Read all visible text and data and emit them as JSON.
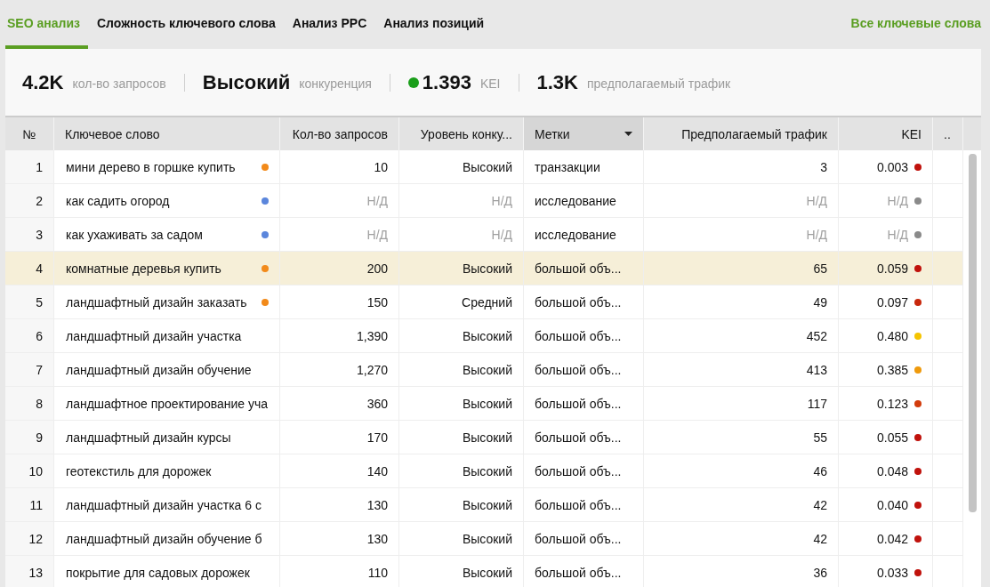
{
  "tabs": [
    {
      "label": "SEO анализ",
      "selected": true
    },
    {
      "label": "Сложность ключевого слова",
      "selected": false
    },
    {
      "label": "Анализ PPC",
      "selected": false
    },
    {
      "label": "Анализ позиций",
      "selected": false
    }
  ],
  "all_keywords_link": "Все ключевые слова",
  "summary": [
    {
      "value": "4.2K",
      "label": "кол-во запросов"
    },
    {
      "value": "Высокий",
      "label": "конкуренция"
    },
    {
      "value": "1.393",
      "label": "KEI",
      "color": "#1a9e1a"
    },
    {
      "value": "1.3K",
      "label": "предполагаемый трафик"
    }
  ],
  "table": {
    "columns": [
      {
        "label": "№",
        "kind": "plain"
      },
      {
        "label": "Ключевое слово",
        "kind": "plain"
      },
      {
        "label": "Кол-во запросов",
        "kind": "plain"
      },
      {
        "label": "Уровень конку...",
        "kind": "plain"
      },
      {
        "label": "Метки",
        "kind": "filter"
      },
      {
        "label": "Предполагаемый трафик",
        "kind": "plain"
      },
      {
        "label": "KEI",
        "kind": "plain"
      },
      {
        "label": "..",
        "kind": "plain"
      }
    ],
    "rows": [
      {
        "n": "1",
        "keyword": {
          "text": "мини дерево в горшке купить",
          "color": "#f28a1a"
        },
        "count": "10",
        "competition": "Высокий",
        "tag": "транзакции",
        "traffic": "3",
        "kei": {
          "value": "0.003",
          "color": "#c0120c"
        },
        "na": false,
        "selected": false
      },
      {
        "n": "2",
        "keyword": {
          "text": "как садить огород",
          "color": "#5b86dc"
        },
        "count": "Н/Д",
        "competition": "Н/Д",
        "tag": "исследование",
        "traffic": "Н/Д",
        "kei": {
          "value": "Н/Д",
          "color": "#8a8a8a"
        },
        "na": true,
        "selected": false
      },
      {
        "n": "3",
        "keyword": {
          "text": "как ухаживать за садом",
          "color": "#5b86dc"
        },
        "count": "Н/Д",
        "competition": "Н/Д",
        "tag": "исследование",
        "traffic": "Н/Д",
        "kei": {
          "value": "Н/Д",
          "color": "#8a8a8a"
        },
        "na": true,
        "selected": false
      },
      {
        "n": "4",
        "keyword": {
          "text": "комнатные деревья купить",
          "color": "#f28a1a"
        },
        "count": "200",
        "competition": "Высокий",
        "tag": "большой объ...",
        "traffic": "65",
        "kei": {
          "value": "0.059",
          "color": "#c0120c"
        },
        "na": false,
        "selected": true
      },
      {
        "n": "5",
        "keyword": {
          "text": "ландшафтный дизайн заказать",
          "color": "#f28a1a"
        },
        "count": "150",
        "competition": "Средний",
        "tag": "большой объ...",
        "traffic": "49",
        "kei": {
          "value": "0.097",
          "color": "#c8280c"
        },
        "na": false,
        "selected": false
      },
      {
        "n": "6",
        "keyword": {
          "text": "ландшафтный дизайн участка"
        },
        "count": "1,390",
        "competition": "Высокий",
        "tag": "большой объ...",
        "traffic": "452",
        "kei": {
          "value": "0.480",
          "color": "#f5c400"
        },
        "na": false,
        "selected": false
      },
      {
        "n": "7",
        "keyword": {
          "text": "ландшафтный дизайн обучение"
        },
        "count": "1,270",
        "competition": "Высокий",
        "tag": "большой объ...",
        "traffic": "413",
        "kei": {
          "value": "0.385",
          "color": "#ef9a0c"
        },
        "na": false,
        "selected": false
      },
      {
        "n": "8",
        "keyword": {
          "text": "ландшафтное проектирование уча"
        },
        "count": "360",
        "competition": "Высокий",
        "tag": "большой объ...",
        "traffic": "117",
        "kei": {
          "value": "0.123",
          "color": "#d23c0c"
        },
        "na": false,
        "selected": false
      },
      {
        "n": "9",
        "keyword": {
          "text": "ландшафтный дизайн курсы"
        },
        "count": "170",
        "competition": "Высокий",
        "tag": "большой объ...",
        "traffic": "55",
        "kei": {
          "value": "0.055",
          "color": "#c0120c"
        },
        "na": false,
        "selected": false
      },
      {
        "n": "10",
        "keyword": {
          "text": "геотекстиль для дорожек"
        },
        "count": "140",
        "competition": "Высокий",
        "tag": "большой объ...",
        "traffic": "46",
        "kei": {
          "value": "0.048",
          "color": "#c0120c"
        },
        "na": false,
        "selected": false
      },
      {
        "n": "11",
        "keyword": {
          "text": "ландшафтный дизайн участка 6 с"
        },
        "count": "130",
        "competition": "Высокий",
        "tag": "большой объ...",
        "traffic": "42",
        "kei": {
          "value": "0.040",
          "color": "#c0120c"
        },
        "na": false,
        "selected": false
      },
      {
        "n": "12",
        "keyword": {
          "text": "ландшафтный дизайн обучение б"
        },
        "count": "130",
        "competition": "Высокий",
        "tag": "большой объ...",
        "traffic": "42",
        "kei": {
          "value": "0.042",
          "color": "#c0120c"
        },
        "na": false,
        "selected": false
      },
      {
        "n": "13",
        "keyword": {
          "text": "покрытие для садовых дорожек"
        },
        "count": "110",
        "competition": "Высокий",
        "tag": "большой объ...",
        "traffic": "36",
        "kei": {
          "value": "0.033",
          "color": "#c0120c"
        },
        "na": false,
        "selected": false
      }
    ]
  }
}
